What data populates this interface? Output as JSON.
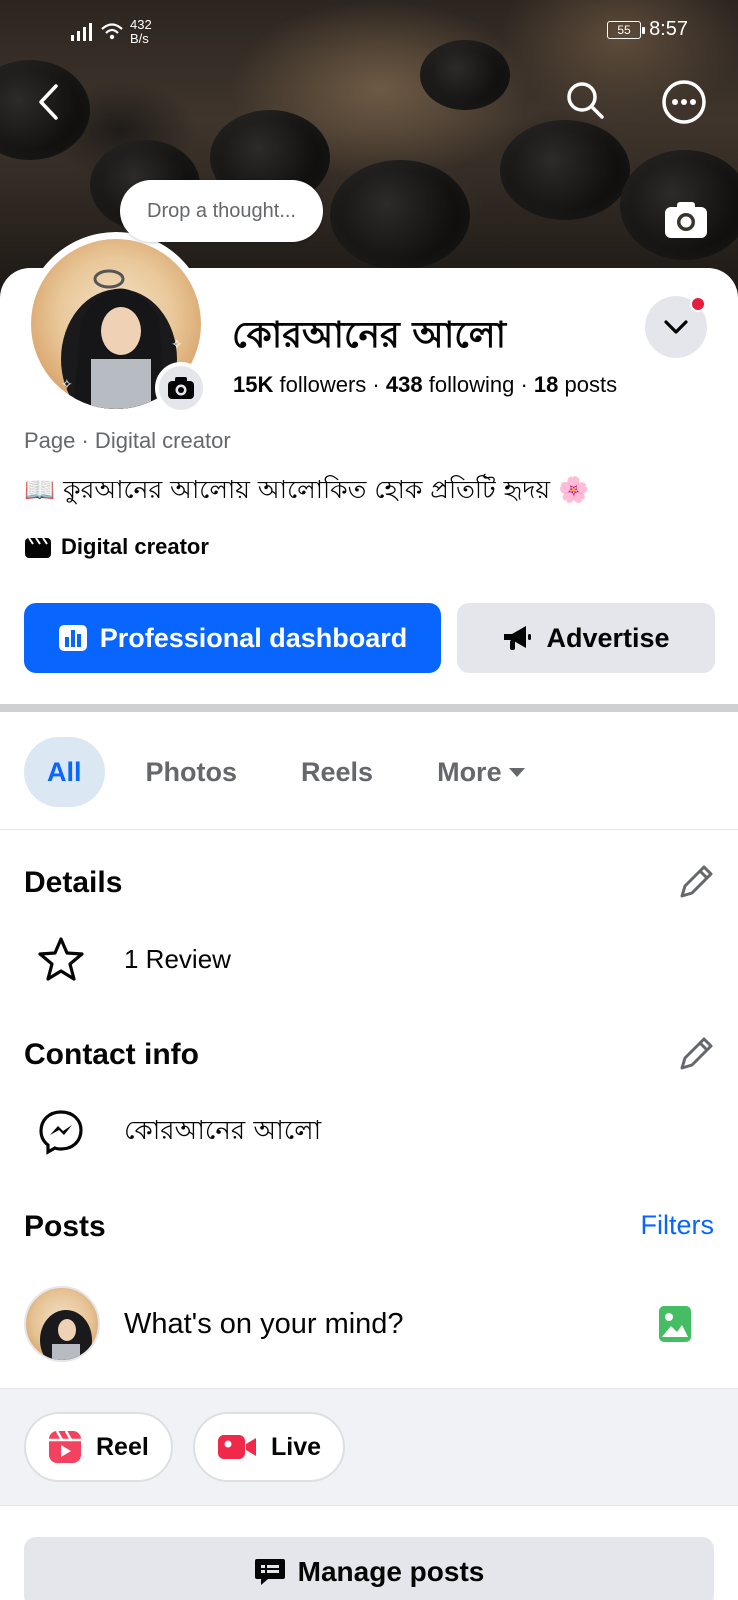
{
  "status_bar": {
    "net_speed": "432",
    "net_unit": "B/s",
    "battery": "55",
    "time": "8:57"
  },
  "cover": {
    "thought_placeholder": "Drop a thought..."
  },
  "profile": {
    "name": "কোরআনের আলো",
    "followers_count": "15K",
    "followers_label": "followers",
    "following_count": "438",
    "following_label": "following",
    "posts_count": "18",
    "posts_label": "posts",
    "category": "Page · Digital creator",
    "bio": "📖 কুরআনের আলোয় আলোকিত হোক প্রতিটি হৃদয় 🌸",
    "creator_label": "Digital creator"
  },
  "actions": {
    "primary": "Professional dashboard",
    "secondary": "Advertise"
  },
  "tabs": [
    {
      "label": "All",
      "active": true
    },
    {
      "label": "Photos"
    },
    {
      "label": "Reels"
    },
    {
      "label": "More"
    }
  ],
  "details": {
    "heading": "Details",
    "review": "1 Review"
  },
  "contact": {
    "heading": "Contact info",
    "messenger_name": "কোরআনের আলো"
  },
  "posts": {
    "heading": "Posts",
    "filters": "Filters",
    "composer_placeholder": "What's on your mind?"
  },
  "create": {
    "reel": "Reel",
    "live": "Live"
  },
  "manage": {
    "label": "Manage posts"
  },
  "colors": {
    "accent": "#0866ff",
    "reel": "#f3425f",
    "live": "#f02849",
    "photo": "#45bd62",
    "notification": "#e41e3f"
  }
}
